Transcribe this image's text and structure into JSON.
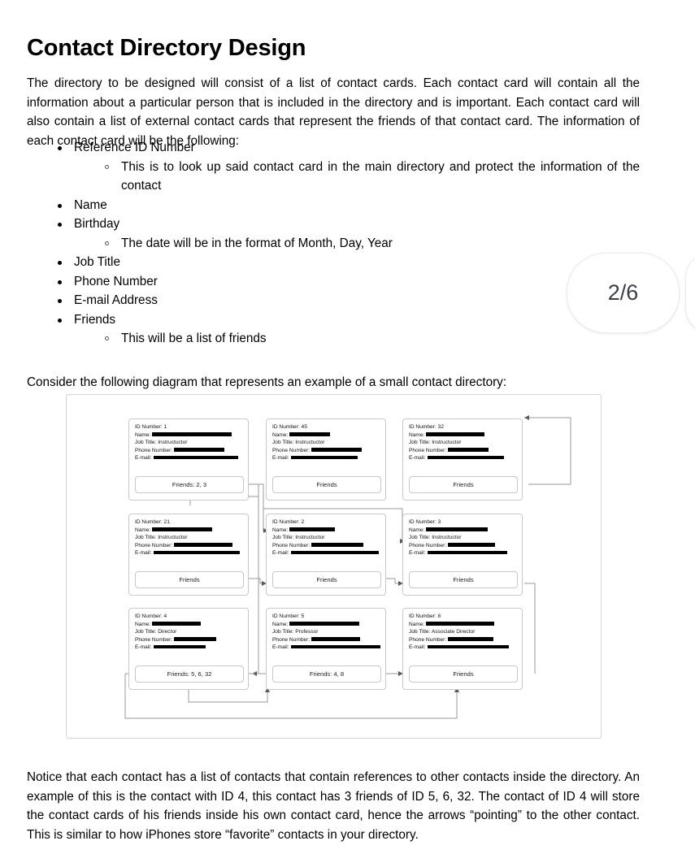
{
  "document": {
    "title": "Contact Directory Design",
    "intro_paragraph": "The directory to be designed will consist of a list of contact cards. Each contact card will contain all the information about a particular person that is included in the directory and is important. Each contact card will also contain a list of external contact cards that represent the friends of that contact card. The information of each contact card will be the following:",
    "consider_paragraph": "Consider the following diagram that represents an example of a small contact directory:",
    "notice_paragraph": "Notice that each contact has a list of contacts that contain references to other contacts inside the directory. An example of this is the contact with ID 4, this contact has 3 friends of ID 5, 6, 32. The contact of ID 4 will store the contact cards of his friends inside his own contact card, hence the arrows “pointing” to the other contact. This is similar to how iPhones store “favorite” contacts in your directory."
  },
  "page_indicator": {
    "label": "2/6",
    "current": 2,
    "total": 6
  },
  "bullets": [
    {
      "level": 1,
      "text": "Reference ID Number"
    },
    {
      "level": 2,
      "text": "This is to look up said contact card in the main directory and protect the information of the contact",
      "justified": true
    },
    {
      "level": 1,
      "text": "Name"
    },
    {
      "level": 1,
      "text": "Birthday"
    },
    {
      "level": 2,
      "text": "The date will be in the format of Month, Day, Year"
    },
    {
      "level": 1,
      "text": "Job Title"
    },
    {
      "level": 1,
      "text": "Phone Number"
    },
    {
      "level": 1,
      "text": "E-mail Address"
    },
    {
      "level": 1,
      "text": "Friends"
    },
    {
      "level": 2,
      "text": "This will be a list of friends"
    }
  ],
  "diagram": {
    "field_labels": {
      "id": "ID Number:",
      "name": "Name:",
      "job": "Job Title:",
      "phone": "Phone Number:",
      "email": "E-mail:"
    },
    "cards": [
      {
        "id_label": "ID Number: 1",
        "name_label": "Name:",
        "job_label": "Job Title: Instructuctor",
        "phone_label": "Phone Number:",
        "email_label": "E-mail:",
        "friends_label": "Friends: 2, 3",
        "name_redacted_width": 98,
        "phone_redacted_width": 62,
        "email_redacted_width": 104
      },
      {
        "id_label": "ID Number: 45",
        "name_label": "Name:",
        "job_label": "Job Title: Instructuctor",
        "phone_label": "Phone Number:",
        "email_label": "E-mail:",
        "friends_label": "Friends",
        "name_redacted_width": 50,
        "phone_redacted_width": 62,
        "email_redacted_width": 82
      },
      {
        "id_label": "ID Number: 32",
        "name_label": "Name:",
        "job_label": "Job Title: Instructuctor",
        "phone_label": "Phone Number:",
        "email_label": "E-mail:",
        "friends_label": "Friends",
        "name_redacted_width": 72,
        "phone_redacted_width": 50,
        "email_redacted_width": 94
      },
      {
        "id_label": "ID Number: 21",
        "name_label": "Name:",
        "job_label": "Job Title: Instructuctor",
        "phone_label": "Phone Number:",
        "email_label": "E-mail:",
        "friends_label": "Friends",
        "name_redacted_width": 74,
        "phone_redacted_width": 72,
        "email_redacted_width": 106
      },
      {
        "id_label": "ID Number: 2",
        "name_label": "Name:",
        "job_label": "Job Title: Instructuctor",
        "phone_label": "Phone Number:",
        "email_label": "E-mail:",
        "friends_label": "Friends",
        "name_redacted_width": 56,
        "phone_redacted_width": 64,
        "email_redacted_width": 108
      },
      {
        "id_label": "ID Number: 3",
        "name_label": "Name:",
        "job_label": "Job Title: Instructuctor",
        "phone_label": "Phone Number:",
        "email_label": "E-mail:",
        "friends_label": "Friends",
        "name_redacted_width": 76,
        "phone_redacted_width": 58,
        "email_redacted_width": 98
      },
      {
        "id_label": "ID Number: 4",
        "name_label": "Name:",
        "job_label": "Job Title: Director",
        "phone_label": "Phone Number:",
        "email_label": "E-mail:",
        "friends_label": "Friends: 5, 6, 32",
        "name_redacted_width": 60,
        "phone_redacted_width": 52,
        "email_redacted_width": 64
      },
      {
        "id_label": "ID Number: 5",
        "name_label": "Name:",
        "job_label": "Job Title: Professor",
        "phone_label": "Phone Number:",
        "email_label": "E-mail:",
        "friends_label": "Friends: 4, 8",
        "name_redacted_width": 86,
        "phone_redacted_width": 60,
        "email_redacted_width": 110
      },
      {
        "id_label": "ID Number: 8",
        "name_label": "Name:",
        "job_label": "Job Title: Associate Director",
        "phone_label": "Phone Number:",
        "email_label": "E-mail:",
        "friends_label": "Friends",
        "name_redacted_width": 84,
        "phone_redacted_width": 56,
        "email_redacted_width": 100
      }
    ]
  },
  "colors": {
    "text": "#000000",
    "card_border": "#c9c9c9",
    "diagram_border": "#d6d6d6",
    "badge_text": "#3c4043",
    "connector": "#8a8a8a",
    "redaction": "#000000"
  }
}
